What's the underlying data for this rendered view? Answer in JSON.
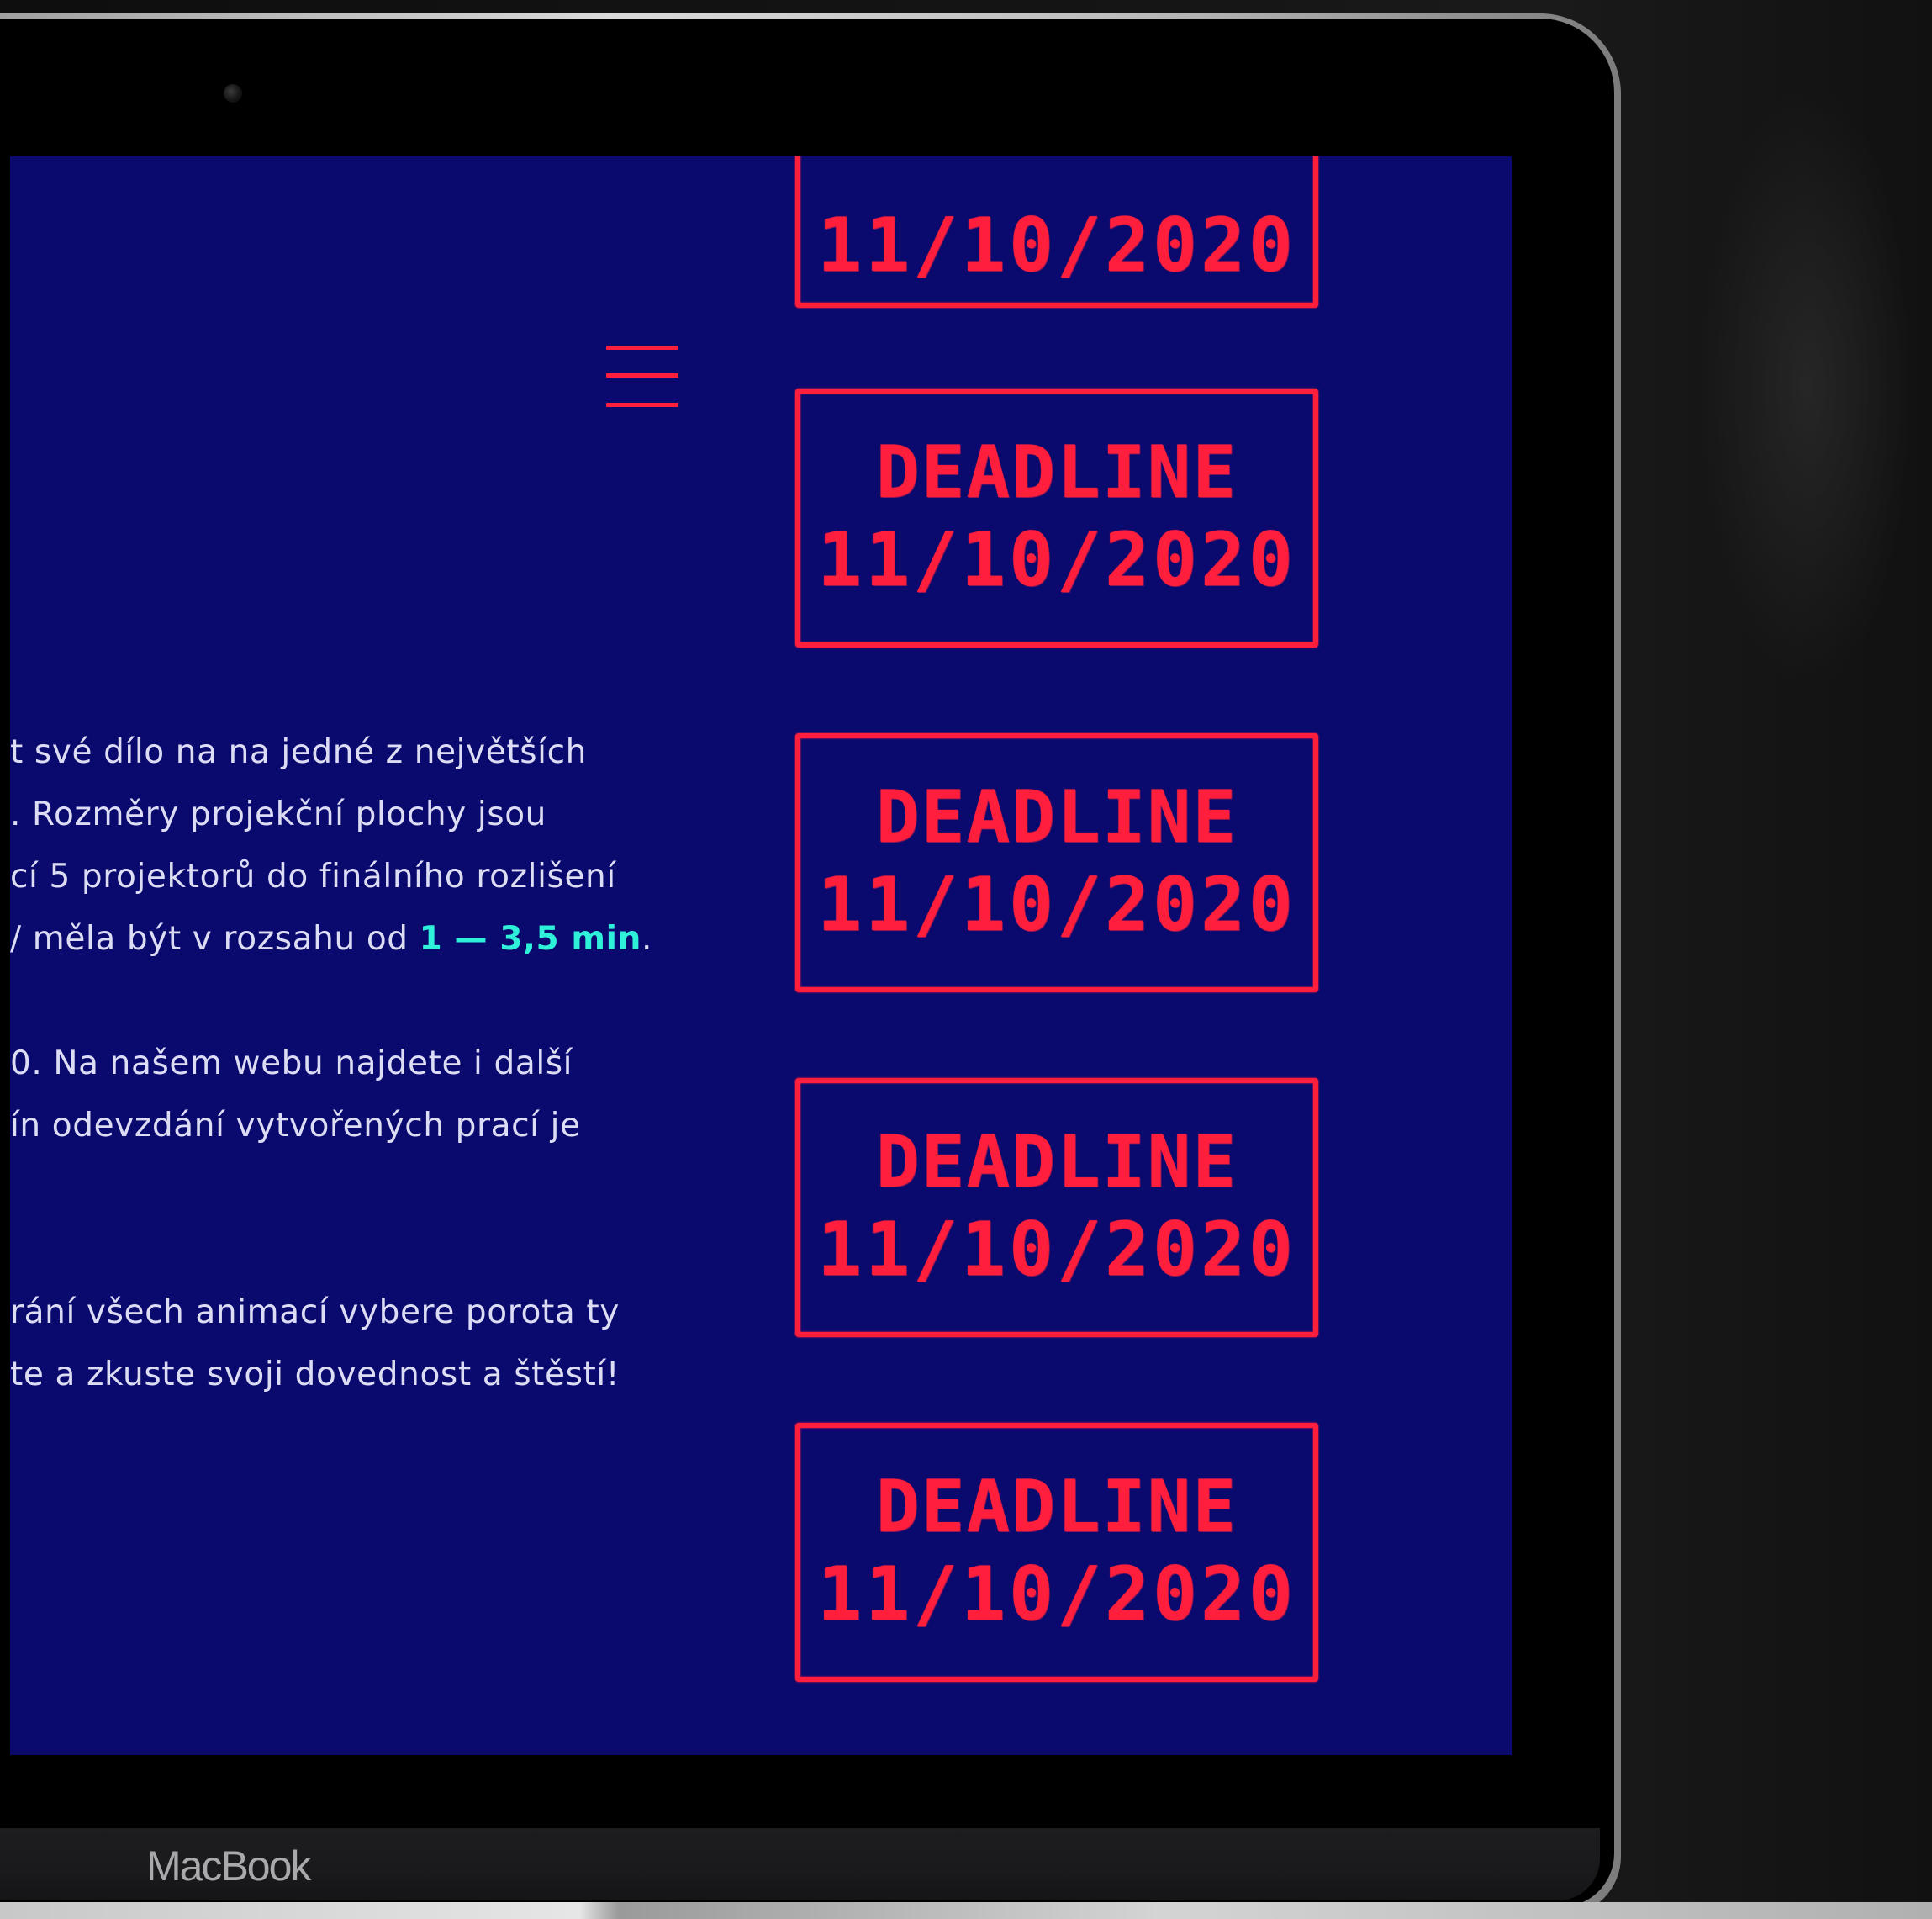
{
  "device": {
    "brand_label": "MacBook"
  },
  "menu": {
    "icon": "hamburger-menu-icon"
  },
  "description": {
    "lines": [
      "t své dílo na na jedné z největších",
      ". Rozměry projekční plochy jsou",
      "cí 5 projektorů do finálního rozlišení",
      "/ měla být v rozsahu od "
    ],
    "duration_highlight": "1 — 3,5 min",
    "duration_suffix": ".",
    "lines2": [
      "0. Na našem webu najdete i další",
      "ín odevzdání vytvořených prací je"
    ],
    "lines3": [
      "rání všech animací vybere porota ty",
      "te a zkuste svoji dovednost a štěstí!"
    ]
  },
  "stamps": [
    {
      "title": "",
      "date": "11/10/2020"
    },
    {
      "title": "DEADLINE",
      "date": "11/10/2020"
    },
    {
      "title": "DEADLINE",
      "date": "11/10/2020"
    },
    {
      "title": "DEADLINE",
      "date": "11/10/2020"
    },
    {
      "title": "DEADLINE",
      "date": "11/10/2020"
    }
  ],
  "colors": {
    "background": "#0a0a6e",
    "accent_red": "#ff1f3d",
    "accent_cyan": "#2ff0d8",
    "text": "#dcdcf4"
  }
}
